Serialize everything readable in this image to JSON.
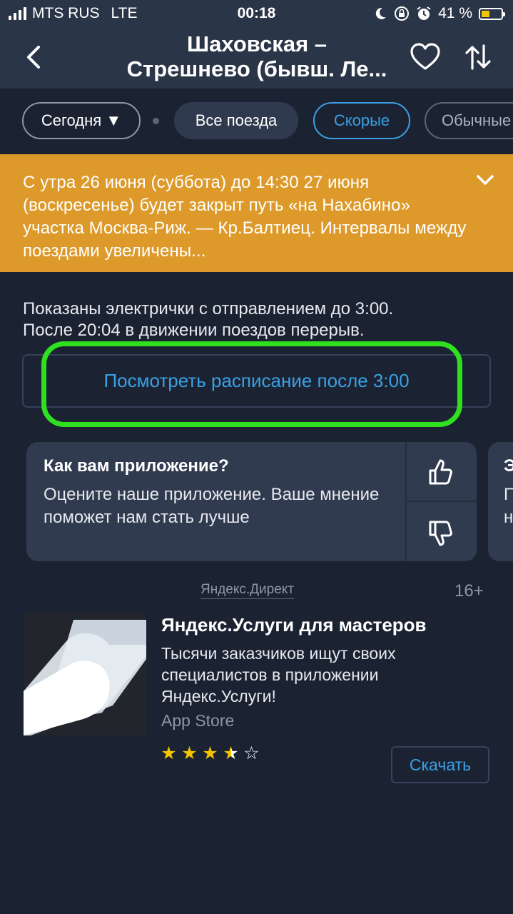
{
  "status_bar": {
    "carrier": "MTS RUS",
    "network": "LTE",
    "time": "00:18",
    "battery_percent": "41 %",
    "battery_level": 0.41
  },
  "header": {
    "title_line1": "Шаховская –",
    "title_line2": "Стрешнево (бывш. Ле..."
  },
  "filters": {
    "today_label": "Сегодня ▼",
    "items": [
      "Все поезда",
      "Скорые",
      "Обычные"
    ],
    "active": "Скорые"
  },
  "alert": {
    "text": "С утра 26 июня (суббота) до 14:30 27 июня (воскресенье) будет закрыт путь «на Нахабино» участка Москва-Риж. — Кр.Балтиец. Интервалы между поездами увеличены..."
  },
  "info": {
    "line1": "Показаны электрички с отправлением до 3:00.",
    "line2": "После 20:04 в движении поездов перерыв."
  },
  "later_button": {
    "label": "Посмотреть расписание после 3:00"
  },
  "rate_card": {
    "title": "Как вам приложение?",
    "text": "Оцените наше приложение. Ваше мнение поможет нам стать лучше"
  },
  "rate_card_2": {
    "title_start": "Э",
    "text_start": "П\nн"
  },
  "ad": {
    "source": "Яндекс.Директ",
    "age": "16+",
    "title": "Яндекс.Услуги для мастеров",
    "description": "Тысячи заказчиков ищут своих специалистов в приложении Яндекс.Услуги!",
    "store": "App Store",
    "rating": 3.5,
    "rating_max": 5,
    "button_label": "Скачать"
  },
  "colors": {
    "background": "#1b2333",
    "header": "#2b3548",
    "accent": "#3aa0e3",
    "alert": "#dd9a2b",
    "highlight": "#2ee01f",
    "star": "#f5c400"
  }
}
